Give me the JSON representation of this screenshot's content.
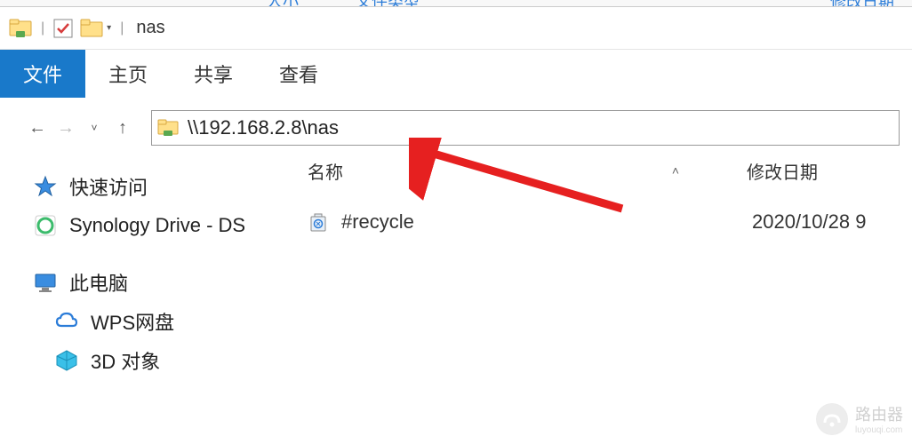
{
  "top_fragment": {
    "col1": "人小",
    "col2": "文件类型",
    "col3": "修改日期"
  },
  "title_bar": {
    "title": "nas"
  },
  "ribbon": {
    "file": "文件",
    "home": "主页",
    "share": "共享",
    "view": "查看"
  },
  "address_bar": {
    "path": "\\\\192.168.2.8\\nas"
  },
  "columns": {
    "name": "名称",
    "date": "修改日期"
  },
  "files": [
    {
      "name": "#recycle",
      "date": "2020/10/28 9"
    }
  ],
  "sidebar": {
    "quick_access": "快速访问",
    "synology_drive": "Synology Drive - DS",
    "this_pc": "此电脑",
    "wps_drive": "WPS网盘",
    "objects_3d": "3D 对象"
  },
  "watermark": {
    "text": "路由器",
    "sub": "luyouqi.com"
  }
}
